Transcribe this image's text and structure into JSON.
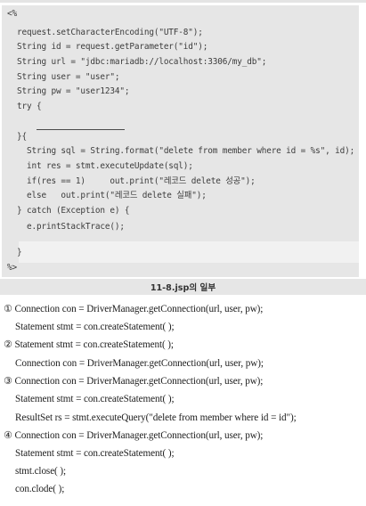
{
  "code": {
    "lines": [
      "<%",
      "  request.setCharacterEncoding(\"UTF-8\");",
      "  String id = request.getParameter(\"id\");",
      "  String url = \"jdbc:mariadb://localhost:3306/my_db\";",
      "  String user = \"user\";",
      "  String pw = \"user1234\";",
      "  try {",
      "",
      "  }{",
      "    String sql = String.format(\"delete from member where id = %s\", id);",
      "    int res = stmt.executeUpdate(sql);",
      "    if(res == 1)     out.print(\"레코드 delete 성공\");",
      "    else   out.print(\"레코드 delete 실패\");",
      "  } catch (Exception e) {",
      "    e.printStackTrace();",
      "  }",
      "%>"
    ]
  },
  "caption": "11-8.jsp의 일부",
  "options": [
    {
      "marker": "①",
      "lines": [
        "Connection con = DriverManager.getConnection(url, user, pw);",
        "Statement stmt = con.createStatement( );"
      ]
    },
    {
      "marker": "②",
      "lines": [
        "Statement stmt = con.createStatement( );",
        "Connection con = DriverManager.getConnection(url, user, pw);"
      ]
    },
    {
      "marker": "③",
      "lines": [
        "Connection con = DriverManager.getConnection(url, user, pw);",
        "Statement stmt = con.createStatement( );",
        "ResultSet rs = stmt.executeQuery(\"delete from member where id = id\");"
      ]
    },
    {
      "marker": "④",
      "lines": [
        "Connection con = DriverManager.getConnection(url, user, pw);",
        "Statement stmt = con.createStatement( );",
        "stmt.close( );",
        "con.clode( );"
      ]
    }
  ]
}
